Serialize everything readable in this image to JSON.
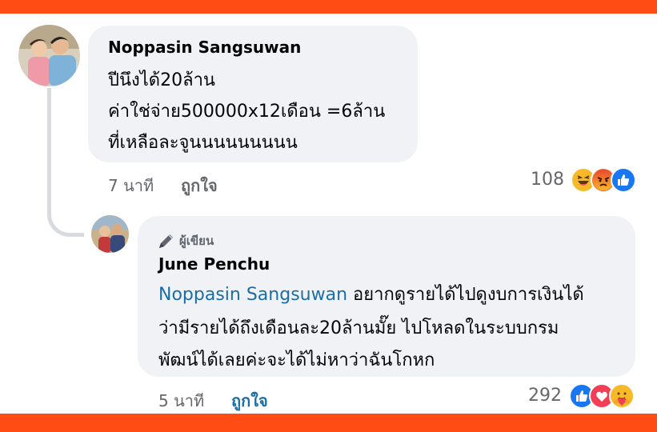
{
  "comments": [
    {
      "author": "Noppasin Sangsuwan",
      "lines": [
        "ปีนึงได้20ล้าน",
        "ค่าใช่จ่าย500000x12เดือน =6ล้าน",
        "ที่เหลือละจูนนนนนนนนน"
      ],
      "time": "7 นาที",
      "like_label": "ถูกใจ",
      "reaction_count": "108",
      "reactions": [
        "haha-icon",
        "angry-icon",
        "like-icon"
      ]
    },
    {
      "badge": "ผู้เขียน",
      "author": "June Penchu",
      "mention": "Noppasin Sangsuwan",
      "line1_rest": " อยากดูรายได้ไปดูงบการเงินได้",
      "line2": "ว่ามีรายได้ถึงเดือนละ20ล้านมั๊ย ไปโหลดในระบบกรม",
      "line3": "พัฒน์ได้เลยค่ะจะได้ไม่หาว่าฉันโกหก",
      "time": "5 นาที",
      "like_label": "ถูกใจ",
      "reaction_count": "292",
      "reactions": [
        "like-icon",
        "love-icon",
        "care-icon"
      ]
    }
  ],
  "colors": {
    "brand_bar": "#ff4b14",
    "bubble": "#f0f2f5",
    "mention": "#1b6ea5",
    "meta_text": "#65676b"
  }
}
